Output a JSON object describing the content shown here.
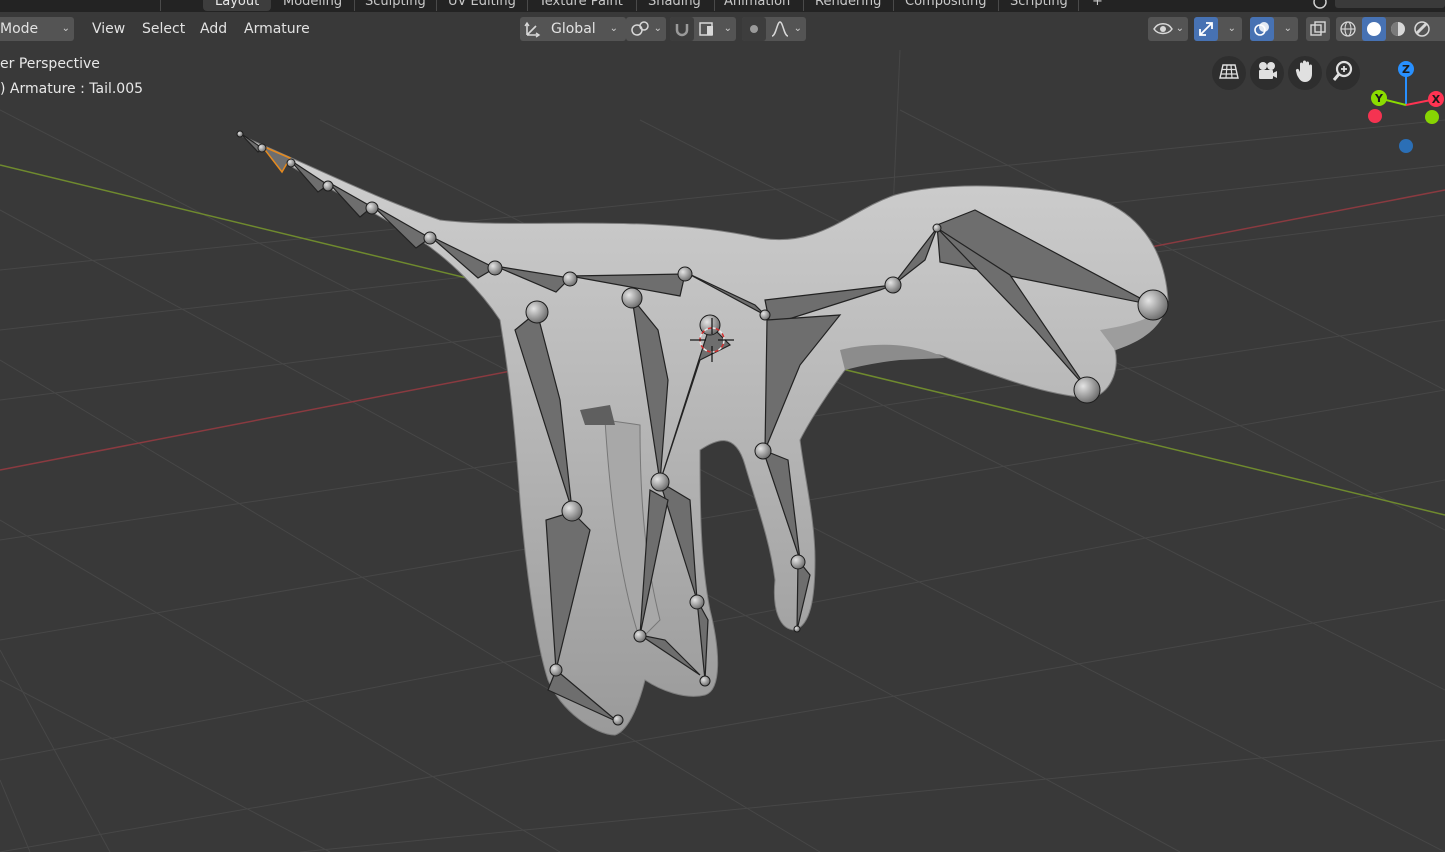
{
  "workspace_tabs": [
    {
      "label": "Layout",
      "active": true
    },
    {
      "label": "Modeling",
      "active": false
    },
    {
      "label": "Sculpting",
      "active": false
    },
    {
      "label": "UV Editing",
      "active": false
    },
    {
      "label": "Texture Paint",
      "active": false
    },
    {
      "label": "Shading",
      "active": false
    },
    {
      "label": "Animation",
      "active": false
    },
    {
      "label": "Rendering",
      "active": false
    },
    {
      "label": "Compositing",
      "active": false
    },
    {
      "label": "Scripting",
      "active": false
    }
  ],
  "header": {
    "mode_label": "Mode",
    "menu": {
      "view": "View",
      "select": "Select",
      "add": "Add",
      "armature": "Armature"
    },
    "transform_orientation": "Global"
  },
  "overlay": {
    "view_name": "er Perspective",
    "object_info": ") Armature : Tail.005"
  },
  "gizmo": {
    "x": "X",
    "y": "Y",
    "z": "Z"
  },
  "icons": {
    "orientation": "transform-orientation-icon",
    "pivot": "pivot-point-icon",
    "snap": "snap-magnet-icon",
    "snap_target": "snap-target-icon",
    "proportional": "proportional-edit-icon",
    "falloff": "falloff-curve-icon",
    "visibility": "eye-icon",
    "gizmos": "gizmo-icon",
    "overlays": "overlays-icon",
    "xray": "xray-icon",
    "shading": [
      "wireframe-shading-icon",
      "solid-shading-icon",
      "material-shading-icon",
      "rendered-shading-icon"
    ],
    "nav": [
      "grid-view-icon",
      "camera-icon",
      "hand-pan-icon",
      "zoom-icon"
    ]
  },
  "colors": {
    "background": "#393939",
    "header_button": "#545454",
    "accent_blue": "#4772b3",
    "axis_x": "#ff3352",
    "axis_y": "#8bdc00",
    "axis_z": "#2890ff"
  }
}
